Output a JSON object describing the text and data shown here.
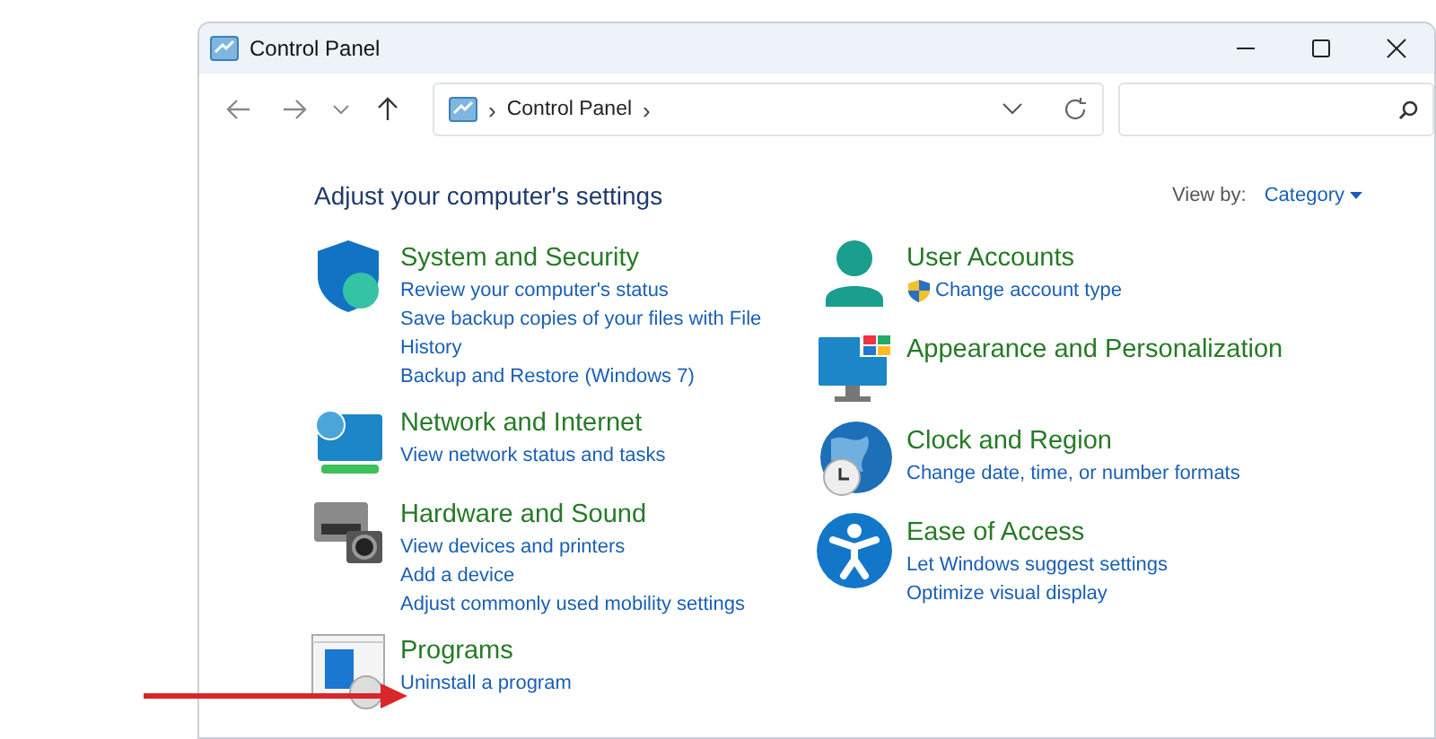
{
  "window": {
    "title": "Control Panel"
  },
  "address_bar": {
    "separator_before": "›",
    "path": "Control Panel",
    "separator_after": "›"
  },
  "heading": "Adjust your computer's settings",
  "view_by": {
    "label": "View by:",
    "value": "Category"
  },
  "columns": [
    [
      {
        "title": "System and Security",
        "links": [
          {
            "text": "Review your computer's status",
            "kind": "plain"
          },
          {
            "text": "Save backup copies of your files with File History",
            "kind": "plain"
          },
          {
            "text": "Backup and Restore (Windows 7)",
            "kind": "plain"
          }
        ]
      },
      {
        "title": "Network and Internet",
        "links": [
          {
            "text": "View network status and tasks",
            "kind": "plain"
          }
        ]
      },
      {
        "title": "Hardware and Sound",
        "links": [
          {
            "text": "View devices and printers",
            "kind": "plain"
          },
          {
            "text": "Add a device",
            "kind": "plain"
          },
          {
            "text": "Adjust commonly used mobility settings",
            "kind": "plain"
          }
        ]
      },
      {
        "title": "Programs",
        "links": [
          {
            "text": "Uninstall a program",
            "kind": "plain"
          }
        ]
      }
    ],
    [
      {
        "title": "User Accounts",
        "links": [
          {
            "text": "Change account type",
            "kind": "admin"
          }
        ]
      },
      {
        "title": "Appearance and Personalization"
      },
      {
        "title": "Clock and Region",
        "links": [
          {
            "text": "Change date, time, or number formats",
            "kind": "plain"
          }
        ]
      },
      {
        "title": "Ease of Access",
        "links": [
          {
            "text": "Let Windows suggest settings",
            "kind": "plain"
          },
          {
            "text": "Optimize visual display",
            "kind": "plain"
          }
        ]
      }
    ]
  ]
}
